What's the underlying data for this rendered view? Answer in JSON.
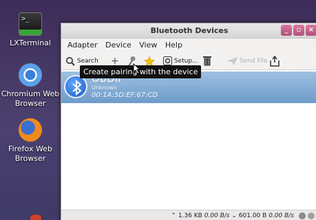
{
  "desktop": {
    "icons": [
      {
        "label": "LXTerminal"
      },
      {
        "label": "Chromium Web Browser"
      },
      {
        "label": "Firefox Web Browser"
      }
    ]
  },
  "window": {
    "title": "Bluetooth Devices",
    "buttons": {
      "minimize": "_",
      "maximize": "▫",
      "close": "×"
    }
  },
  "menu": [
    "Adapter",
    "Device",
    "View",
    "Help"
  ],
  "toolbar": {
    "search": "Search",
    "add": "+",
    "setup": "Setup...",
    "send_file": "Send File"
  },
  "tooltip": "Create pairing with the device",
  "device": {
    "name": "OBDII",
    "class": "Unknown",
    "address": "00:1A:5D:EF:67:CD"
  },
  "status": {
    "up_arrow": "⌃",
    "up_total": "1.36 KB",
    "up_rate": "0.00 B/s",
    "down_arrow": "⌄",
    "down_total": "601.00 B",
    "down_rate": "0.00 B/s"
  }
}
